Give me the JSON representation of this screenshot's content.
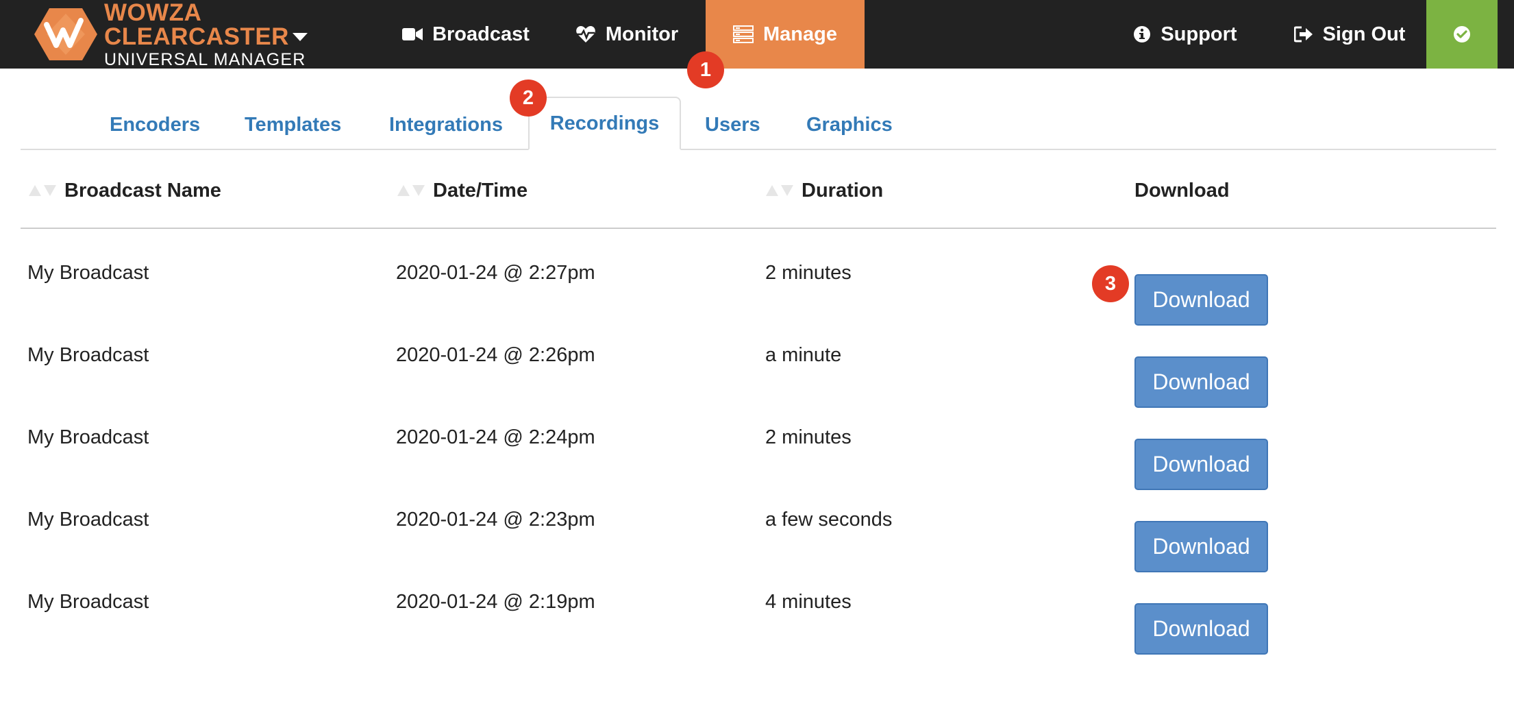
{
  "brand": {
    "title": "WOWZA CLEARCASTER",
    "subtitle": "UNIVERSAL MANAGER",
    "accent_color": "#e8874a"
  },
  "nav": {
    "broadcast": "Broadcast",
    "monitor": "Monitor",
    "manage": "Manage",
    "support": "Support",
    "sign_out": "Sign Out",
    "status_icon": "check-circle-icon",
    "status_color": "#7cb342"
  },
  "callouts": [
    "1",
    "2",
    "3"
  ],
  "tabs": {
    "encoders": "Encoders",
    "templates": "Templates",
    "integrations": "Integrations",
    "recordings": "Recordings",
    "users": "Users",
    "graphics": "Graphics",
    "active": "Recordings"
  },
  "table": {
    "headers": {
      "name": "Broadcast Name",
      "date": "Date/Time",
      "duration": "Duration",
      "download": "Download"
    },
    "rows": [
      {
        "name": "My Broadcast",
        "date": "2020-01-24 @ 2:27pm",
        "duration": "2 minutes",
        "action": "Download"
      },
      {
        "name": "My Broadcast",
        "date": "2020-01-24 @ 2:26pm",
        "duration": "a minute",
        "action": "Download"
      },
      {
        "name": "My Broadcast",
        "date": "2020-01-24 @ 2:24pm",
        "duration": "2 minutes",
        "action": "Download"
      },
      {
        "name": "My Broadcast",
        "date": "2020-01-24 @ 2:23pm",
        "duration": "a few seconds",
        "action": "Download"
      },
      {
        "name": "My Broadcast",
        "date": "2020-01-24 @ 2:19pm",
        "duration": "4 minutes",
        "action": "Download"
      }
    ]
  },
  "colors": {
    "navbar": "#222222",
    "link": "#337ab7",
    "button": "#5b8fcb",
    "callout": "#e33b25"
  }
}
